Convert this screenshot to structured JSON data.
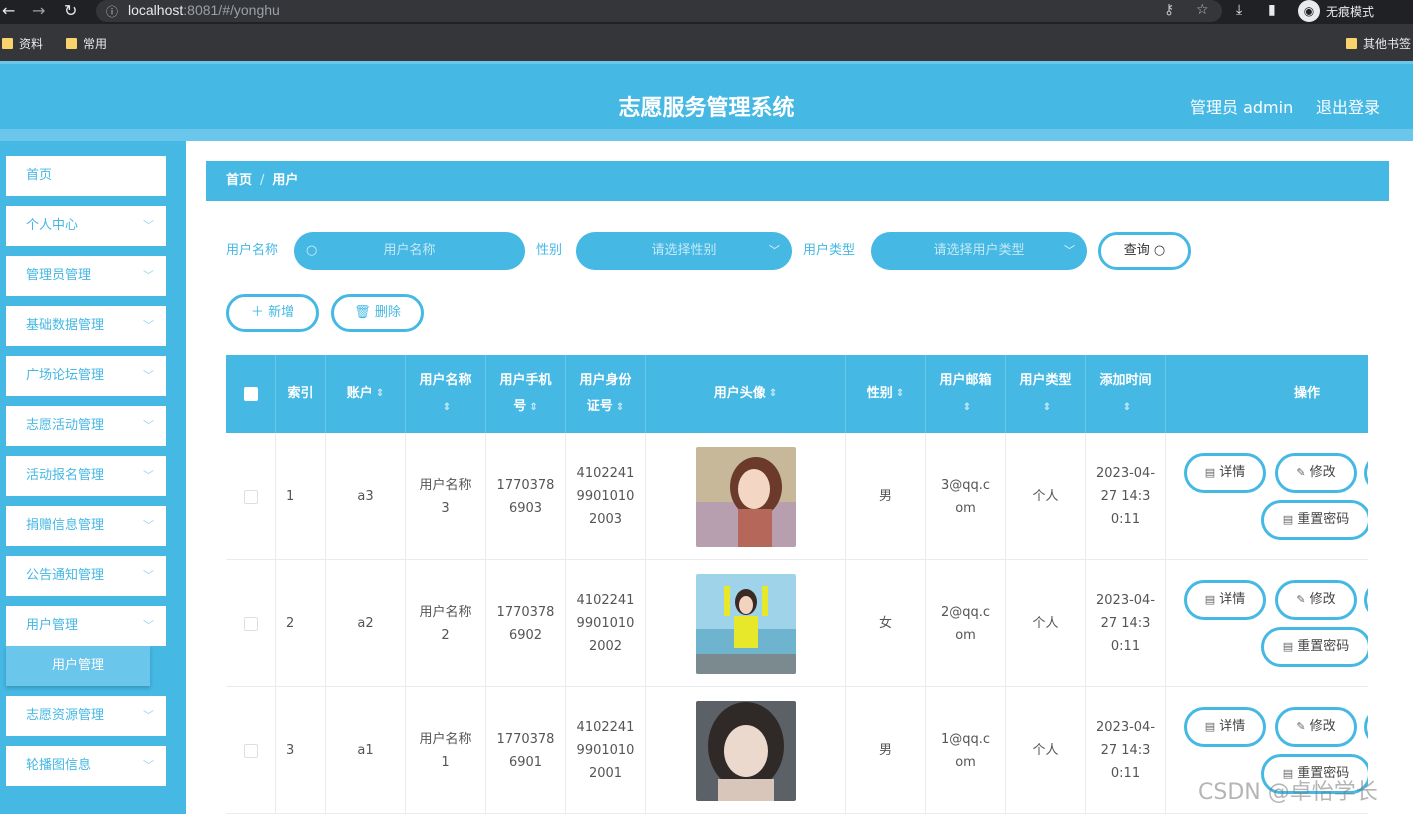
{
  "browser": {
    "url_host": "localhost",
    "url_rest": ":8081/#/yonghu",
    "incognito_label": "无痕模式",
    "bookmarks": [
      "资料",
      "常用"
    ],
    "other_bookmarks": "其他书签"
  },
  "header": {
    "title": "志愿服务管理系统",
    "admin_label": "管理员 admin",
    "logout": "退出登录"
  },
  "sidebar": {
    "items": [
      {
        "label": "首页"
      },
      {
        "label": "个人中心"
      },
      {
        "label": "管理员管理"
      },
      {
        "label": "基础数据管理"
      },
      {
        "label": "广场论坛管理"
      },
      {
        "label": "志愿活动管理"
      },
      {
        "label": "活动报名管理"
      },
      {
        "label": "捐赠信息管理"
      },
      {
        "label": "公告通知管理"
      },
      {
        "label": "用户管理"
      },
      {
        "label": "志愿资源管理"
      },
      {
        "label": "轮播图信息"
      }
    ],
    "active_sub": "用户管理"
  },
  "breadcrumb": {
    "home": "首页",
    "current": "用户"
  },
  "search": {
    "name_label": "用户名称",
    "name_placeholder": "用户名称",
    "gender_label": "性别",
    "gender_placeholder": "请选择性别",
    "type_label": "用户类型",
    "type_placeholder": "请选择用户类型",
    "query_button": "查询"
  },
  "actions": {
    "add": "新增",
    "delete": "删除"
  },
  "table": {
    "headers": {
      "index": "索引",
      "account": "账户",
      "name": "用户名称",
      "phone": "用户手机号",
      "id_card": "用户身份证号",
      "avatar": "用户头像",
      "gender": "性别",
      "email": "用户邮箱",
      "type": "用户类型",
      "added": "添加时间",
      "ops": "操作"
    },
    "buttons": {
      "detail": "详情",
      "edit": "修改",
      "reset": "重置密码"
    },
    "rows": [
      {
        "index": "1",
        "account": "a3",
        "name": "用户名称3",
        "phone": "17703786903",
        "id_card": "410224199010102003",
        "gender": "男",
        "email": "3@qq.com",
        "type": "个人",
        "added": "2023-04-27 14:30:11"
      },
      {
        "index": "2",
        "account": "a2",
        "name": "用户名称2",
        "phone": "17703786902",
        "id_card": "410224199010102002",
        "gender": "女",
        "email": "2@qq.com",
        "type": "个人",
        "added": "2023-04-27 14:30:11"
      },
      {
        "index": "3",
        "account": "a1",
        "name": "用户名称1",
        "phone": "17703786901",
        "id_card": "410224199010102001",
        "gender": "男",
        "email": "1@qq.com",
        "type": "个人",
        "added": "2023-04-27 14:30:11"
      }
    ]
  },
  "watermark": "CSDN @卓怡学长",
  "colors": {
    "primary": "#45b8e4",
    "light": "#6ac6ea",
    "chrome": "#202124"
  }
}
